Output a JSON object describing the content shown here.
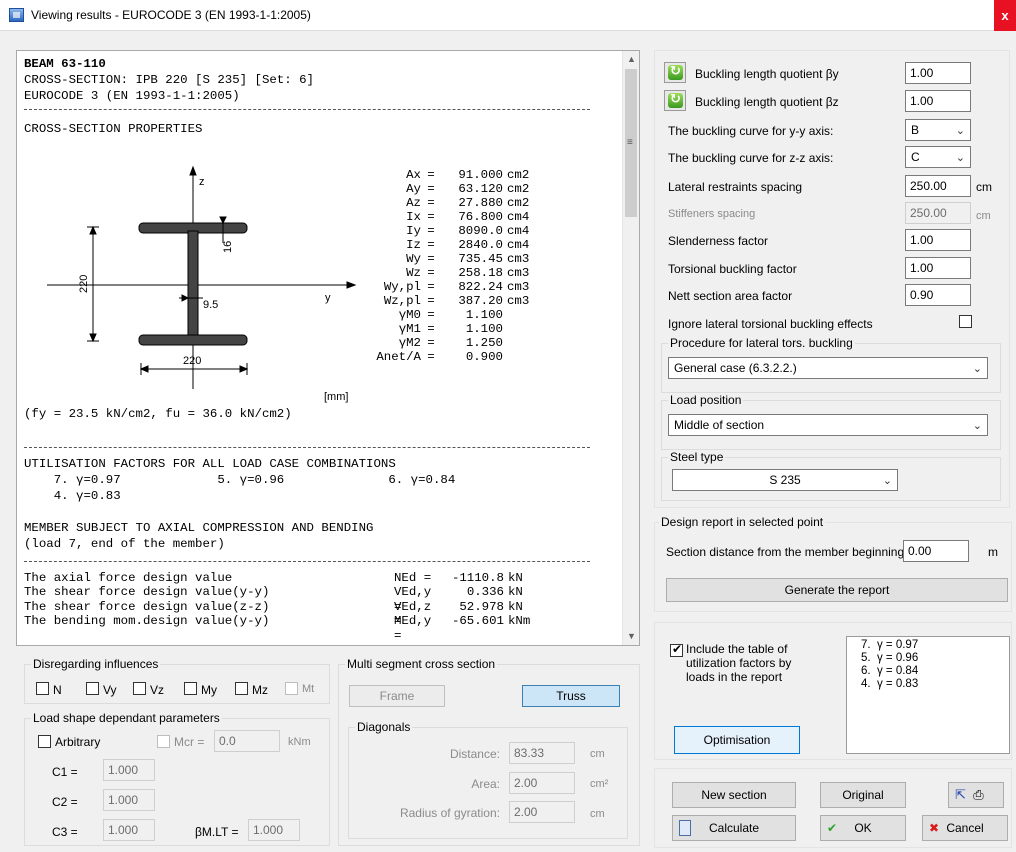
{
  "window": {
    "title": "Viewing results - EUROCODE 3 (EN 1993-1-1:2005)",
    "close_label": "x"
  },
  "report": {
    "header": [
      "BEAM 63-110",
      "CROSS-SECTION: IPB 220 [S 235] [Set: 6]",
      "EUROCODE 3 (EN 1993-1-1:2005)"
    ],
    "separator": "-----------------------------------------------------------",
    "section_props_title": "CROSS-SECTION PROPERTIES",
    "props": [
      {
        "name": "Ax",
        "value": "91.000",
        "unit": "cm2"
      },
      {
        "name": "Ay",
        "value": "63.120",
        "unit": "cm2"
      },
      {
        "name": "Az",
        "value": "27.880",
        "unit": "cm2"
      },
      {
        "name": "Ix",
        "value": "76.800",
        "unit": "cm4"
      },
      {
        "name": "Iy",
        "value": "8090.0",
        "unit": "cm4"
      },
      {
        "name": "Iz",
        "value": "2840.0",
        "unit": "cm4"
      },
      {
        "name": "Wy",
        "value": "735.45",
        "unit": "cm3"
      },
      {
        "name": "Wz",
        "value": "258.18",
        "unit": "cm3"
      },
      {
        "name": "Wy,pl",
        "value": "822.24",
        "unit": "cm3"
      },
      {
        "name": "Wz,pl",
        "value": "387.20",
        "unit": "cm3"
      },
      {
        "name": "γM0",
        "value": "1.100",
        "unit": ""
      },
      {
        "name": "γM1",
        "value": "1.100",
        "unit": ""
      },
      {
        "name": "γM2",
        "value": "1.250",
        "unit": ""
      },
      {
        "name": "Anet/A",
        "value": "0.900",
        "unit": ""
      }
    ],
    "drawing": {
      "axis_z": "z",
      "axis_y": "y",
      "height": "220",
      "width": "220",
      "flange": "16",
      "web": "9.5",
      "units": "[mm]"
    },
    "material": "(fy = 23.5 kN/cm2, fu = 36.0 kN/cm2)",
    "util_title": "UTILISATION FACTORS FOR ALL LOAD CASE COMBINATIONS",
    "util_line1": "    7. γ=0.97             5. γ=0.96              6. γ=0.84",
    "util_line2": "    4. γ=0.83",
    "member_title": "MEMBER SUBJECT TO AXIAL COMPRESSION AND BENDING",
    "member_sub": "(load 7, end of the member)",
    "forces": [
      {
        "name": "The axial force design value",
        "sym": "NEd =",
        "value": "-1110.8",
        "unit": "kN"
      },
      {
        "name": "The shear force design value(y-y)",
        "sym": "VEd,y =",
        "value": "0.336",
        "unit": "kN"
      },
      {
        "name": "The shear force design value(z-z)",
        "sym": "VEd,z =",
        "value": "52.978",
        "unit": "kN"
      },
      {
        "name": "The bending mom.design value(y-y)",
        "sym": "MEd,y =",
        "value": "-65.601",
        "unit": "kNm"
      }
    ]
  },
  "params": {
    "buckling_y_label": "Buckling length quotient βy",
    "buckling_y": "1.00",
    "buckling_z_label": "Buckling length quotient βz",
    "buckling_z": "1.00",
    "curve_y_label": "The buckling curve for y-y axis:",
    "curve_y": "B",
    "curve_z_label": "The buckling curve for z-z axis:",
    "curve_z": "C",
    "lateral_label": "Lateral restraints spacing",
    "lateral": "250.00",
    "lateral_unit": "cm",
    "stiff_label": "Stiffeners spacing",
    "stiff": "250.00",
    "stiff_unit": "cm",
    "slender_label": "Slenderness factor",
    "slender": "1.00",
    "torsional_label": "Torsional buckling factor",
    "torsional": "1.00",
    "nett_label": "Nett section area factor",
    "nett": "0.90",
    "ignore_label": "Ignore lateral torsional buckling effects",
    "procedure_title": "Procedure for lateral tors. buckling",
    "procedure": "General case (6.3.2.2.)",
    "load_pos_title": "Load position",
    "load_pos": "Middle of section",
    "steel_title": "Steel type",
    "steel": "S 235"
  },
  "design_report": {
    "title": "Design report in selected point",
    "distance_label": "Section distance from the member beginning",
    "distance": "0.00",
    "distance_unit": "m",
    "generate_label": "Generate the report"
  },
  "include": {
    "label_lines": [
      "Include the table of",
      "utilization factors by",
      "loads in the report"
    ],
    "optimisation_label": "Optimisation",
    "list": [
      "7.  γ = 0.97",
      "5.  γ = 0.96",
      "6.  γ = 0.84",
      "4.  γ = 0.83"
    ]
  },
  "disregard": {
    "title": "Disregarding influences",
    "items": [
      "N",
      "Vy",
      "Vz",
      "My",
      "Mz",
      "Mt"
    ]
  },
  "load_shape": {
    "title": "Load shape dependant parameters",
    "arbitrary_label": "Arbitrary",
    "mcr_label": "Mcr =",
    "mcr": "0.0",
    "mcr_unit": "kNm",
    "c1_label": "C1 =",
    "c1": "1.000",
    "c2_label": "C2 =",
    "c2": "1.000",
    "c3_label": "C3 =",
    "c3": "1.000",
    "bm_label": "βM.LT =",
    "bm": "1.000"
  },
  "multi": {
    "title": "Multi segment cross section",
    "frame_label": "Frame",
    "truss_label": "Truss",
    "diagonals_title": "Diagonals",
    "distance_label": "Distance:",
    "distance": "83.33",
    "distance_unit": "cm",
    "area_label": "Area:",
    "area": "2.00",
    "area_unit": "cm²",
    "radius_label": "Radius of gyration:",
    "radius": "2.00",
    "radius_unit": "cm"
  },
  "actions": {
    "new_section": "New section",
    "original": "Original",
    "calculate": "Calculate",
    "ok": "OK",
    "cancel": "Cancel"
  }
}
